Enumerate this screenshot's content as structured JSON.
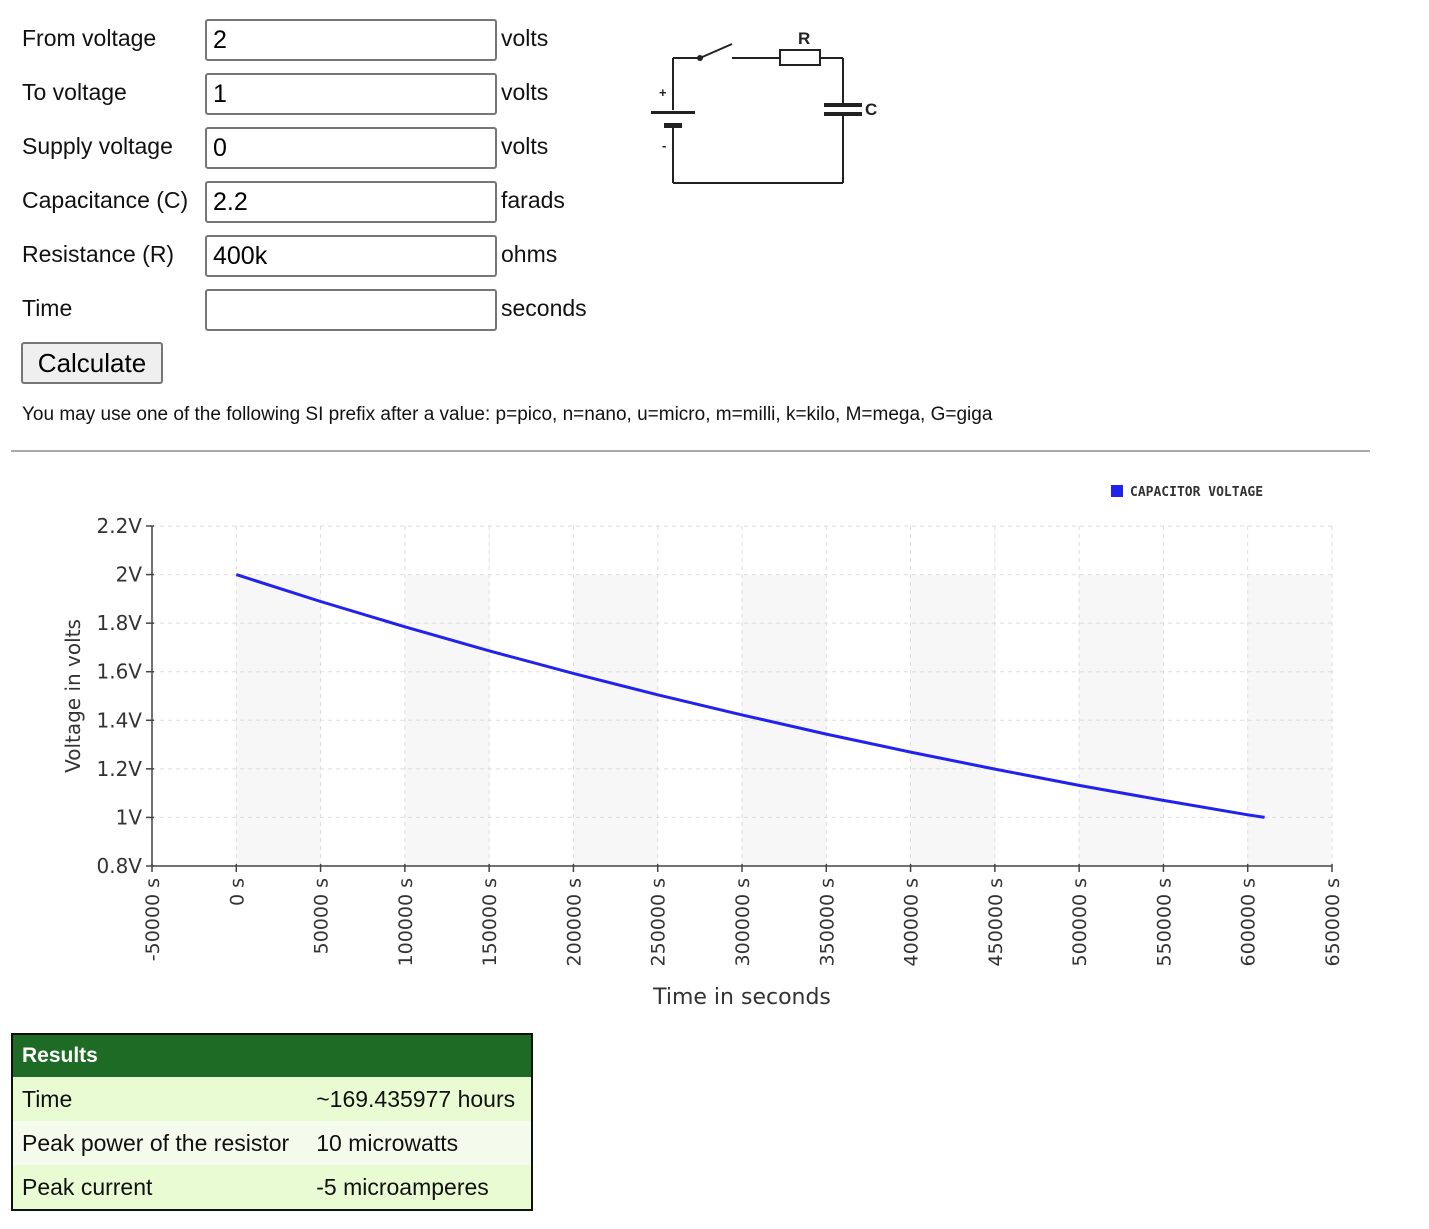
{
  "form": {
    "fields": [
      {
        "label": "From voltage",
        "value": "2",
        "unit": "volts"
      },
      {
        "label": "To voltage",
        "value": "1",
        "unit": "volts"
      },
      {
        "label": "Supply voltage",
        "value": "0",
        "unit": "volts"
      },
      {
        "label": "Capacitance (C)",
        "value": "2.2",
        "unit": "farads"
      },
      {
        "label": "Resistance (R)",
        "value": "400k",
        "unit": "ohms"
      },
      {
        "label": "Time",
        "value": "",
        "unit": "seconds"
      }
    ],
    "calculate_label": "Calculate",
    "hint": "You may use one of the following SI prefix after a value: p=pico, n=nano, u=micro, m=milli, k=kilo, M=mega, G=giga"
  },
  "circuit": {
    "resistor_label": "R",
    "capacitor_label": "C",
    "plus": "+",
    "minus": "-"
  },
  "chart_data": {
    "type": "line",
    "xlabel": "Time in seconds",
    "ylabel": "Voltage in volts",
    "xlim": [
      -50000,
      650000
    ],
    "ylim": [
      0.8,
      2.2
    ],
    "x_ticks": [
      "-50000 s",
      "0 s",
      "50000 s",
      "100000 s",
      "150000 s",
      "200000 s",
      "250000 s",
      "300000 s",
      "350000 s",
      "400000 s",
      "450000 s",
      "500000 s",
      "550000 s",
      "600000 s",
      "650000 s"
    ],
    "x_tick_values": [
      -50000,
      0,
      50000,
      100000,
      150000,
      200000,
      250000,
      300000,
      350000,
      400000,
      450000,
      500000,
      550000,
      600000,
      650000
    ],
    "y_ticks": [
      "2.2V",
      "2V",
      "1.8V",
      "1.6V",
      "1.4V",
      "1.2V",
      "1V",
      "0.8V"
    ],
    "y_tick_values": [
      2.2,
      2.0,
      1.8,
      1.6,
      1.4,
      1.2,
      1.0,
      0.8
    ],
    "grid": true,
    "legend_position": "top-right",
    "series": [
      {
        "name": "CAPACITOR VOLTAGE",
        "color": "#2222ee",
        "x": [
          0,
          50000,
          100000,
          150000,
          200000,
          250000,
          300000,
          350000,
          400000,
          450000,
          500000,
          550000,
          600000,
          610000
        ],
        "y": [
          2.0,
          1.889,
          1.785,
          1.686,
          1.593,
          1.505,
          1.422,
          1.343,
          1.269,
          1.199,
          1.132,
          1.07,
          1.011,
          1.0
        ]
      }
    ]
  },
  "results": {
    "header": "Results",
    "rows": [
      {
        "label": "Time",
        "value": "~169.435977 hours"
      },
      {
        "label": "Peak power of the resistor",
        "value": "10 microwatts"
      },
      {
        "label": "Peak current",
        "value": "-5 microamperes"
      }
    ]
  },
  "colors": {
    "results_header": "#1d6b25",
    "series_line": "#2222ee"
  }
}
